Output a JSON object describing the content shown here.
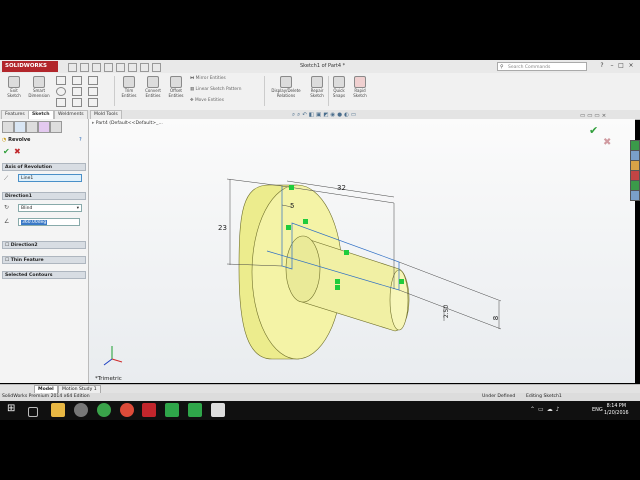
{
  "app": {
    "brand": "SOLIDWORKS",
    "document_title": "Sketch1 of Part4 *",
    "search_placeholder": "Search Commands"
  },
  "ribbon": {
    "exit_sketch": "Exit Sketch",
    "smart_dimension": "Smart Dimension",
    "trim_entities": "Trim Entities",
    "convert_entities": "Convert Entities",
    "offset_entities": "Offset Entities",
    "mirror_entities": "Mirror Entities",
    "linear_sketch_pattern": "Linear Sketch Pattern",
    "move_entities": "Move Entities",
    "display_delete_relations": "Display/Delete Relations",
    "repair_sketch": "Repair Sketch",
    "quick_snaps": "Quick Snaps",
    "rapid_sketch": "Rapid Sketch"
  },
  "tabs": [
    "Features",
    "Sketch",
    "Weldments",
    "Mold Tools"
  ],
  "active_tab": "Sketch",
  "tree_path": "Part4  (Default<<Default>_...",
  "property_manager": {
    "title": "Revolve",
    "axis_section": "Axis of Revolution",
    "axis_value": "Line1",
    "direction1_section": "Direction1",
    "direction1_type": "Blind",
    "direction1_angle": "360.00deg",
    "direction2_section": "Direction2",
    "thin_feature_section": "Thin Feature",
    "selected_contours_section": "Selected Contours"
  },
  "dimensions": {
    "d32": "32",
    "d5": "5",
    "d23": "23",
    "d250": "2.50",
    "d8": "8"
  },
  "view_label": "*Trimetric",
  "bottom_tabs": [
    "Model",
    "Motion Study 1"
  ],
  "status": {
    "edition": "SolidWorks Premium 2014 x64 Edition",
    "state": "Under Defined",
    "editing": "Editing Sketch1"
  },
  "taskbar": {
    "language": "ENG",
    "time": "8:14 PM",
    "date": "1/20/2016"
  },
  "colors": {
    "brand_red": "#b2262b",
    "accent_green": "#2f9e3a",
    "part_yellow": "#f4f3a6"
  }
}
